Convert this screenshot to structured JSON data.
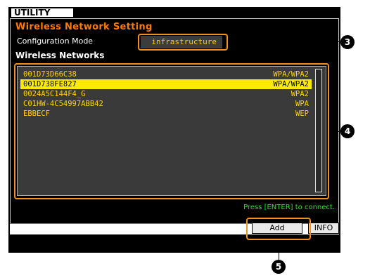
{
  "window": {
    "tab_label": "UTILITY"
  },
  "section_title": "Wireless Network Setting",
  "configuration": {
    "label": "Configuration Mode",
    "value": "infrastructure"
  },
  "networks": {
    "title": "Wireless Networks",
    "rows": [
      {
        "ssid": "001D73D66C38",
        "security": "WPA/WPA2",
        "selected": false
      },
      {
        "ssid": "001D738FE827",
        "security": "WPA/WPA2",
        "selected": true
      },
      {
        "ssid": "0024A5C144F4_G",
        "security": "WPA2",
        "selected": false
      },
      {
        "ssid": "C01HW-4C54997ABB42",
        "security": "WPA",
        "selected": false
      },
      {
        "ssid": "EBBECF",
        "security": "WEP",
        "selected": false
      }
    ]
  },
  "status_message": "Press [ENTER] to connect.",
  "buttons": {
    "add": "Add",
    "info": "INFO"
  },
  "callouts": {
    "config": "3",
    "list": "4",
    "add": "5"
  },
  "colors": {
    "highlight": "#f2921d",
    "selection": "#ffea00",
    "list_text": "#ffd200",
    "title": "#ff7a00",
    "message": "#27e827"
  }
}
